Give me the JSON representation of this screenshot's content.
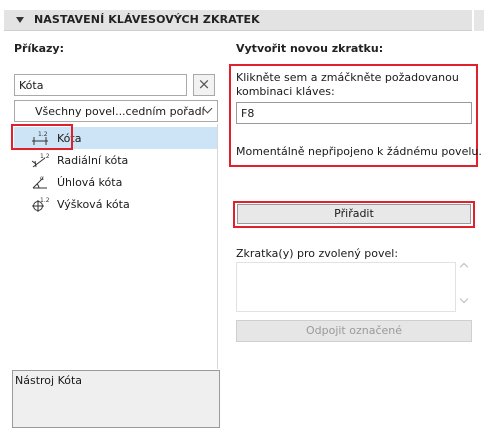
{
  "header": {
    "title": "NASTAVENÍ KLÁVESOVÝCH ZKRATEK"
  },
  "left": {
    "commands_label": "Příkazy:",
    "search_value": "Kóta",
    "clear_glyph": "×",
    "sort_value": "Všechny povel...cedním pořadí",
    "items": [
      {
        "label": "Kóta",
        "icon": "linear-dimension-icon",
        "selected": true
      },
      {
        "label": "Radiální kóta",
        "icon": "radial-dimension-icon",
        "selected": false
      },
      {
        "label": "Úhlová kóta",
        "icon": "angle-dimension-icon",
        "selected": false
      },
      {
        "label": "Výšková kóta",
        "icon": "level-dimension-icon",
        "selected": false
      }
    ],
    "description": "Nástroj Kóta"
  },
  "right": {
    "new_shortcut_label": "Vytvořit novou zkratku:",
    "hint": "Klikněte sem a zmáčkněte požadovanou kombinaci kláves:",
    "key_value": "F8",
    "status": "Momentálně nepřipojeno k žádnému povelu.",
    "assign_label": "Přiřadit",
    "shortcuts_label": "Zkratka(y) pro zvolený povel:",
    "detach_label": "Odpojit označené"
  },
  "colors": {
    "highlight": "#e0202a",
    "selection": "#cde4f7",
    "header_bg": "#e3e3e3"
  }
}
